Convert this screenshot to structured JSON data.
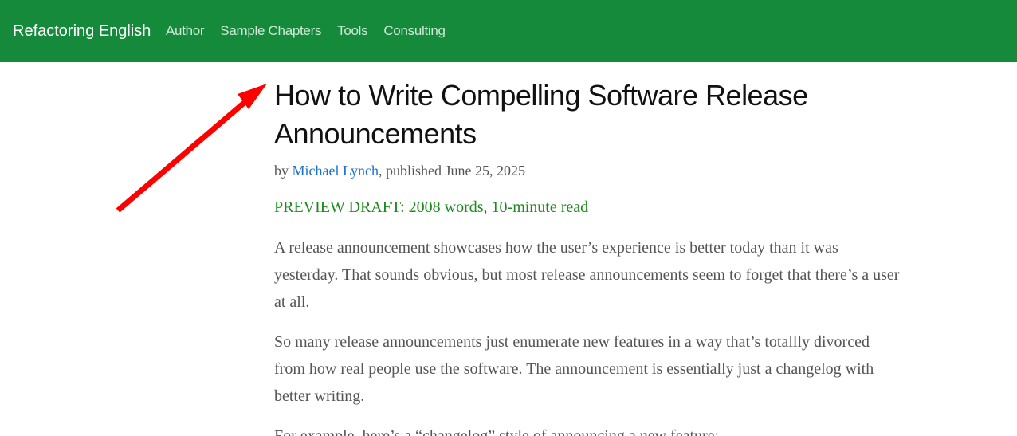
{
  "navbar": {
    "brand": "Refactoring English",
    "links": [
      {
        "label": "Author"
      },
      {
        "label": "Sample Chapters"
      },
      {
        "label": "Tools"
      },
      {
        "label": "Consulting"
      }
    ]
  },
  "article": {
    "title": "How to Write Compelling Software Release Announcements",
    "byline_prefix": "by ",
    "author": "Michael Lynch",
    "byline_suffix": ", published June 25, 2025",
    "preview": "PREVIEW DRAFT: 2008 words, 10-minute read",
    "paragraphs": [
      "A release announcement showcases how the user’s experience is better today than it was yesterday. That sounds obvious, but most release announcements seem to forget that there’s a user at all.",
      "So many release announcements just enumerate new features in a way that’s totallly divorced from how real people use the software. The announcement is essentially just a changelog with better writing.",
      "For example, here’s a “changelog” style of announcing a new feature:"
    ]
  },
  "colors": {
    "navbar_bg": "#148a3a",
    "link_blue": "#1a6fd1",
    "preview_green": "#1d8a1d",
    "arrow_red": "#ff0000"
  },
  "annotation": {
    "icon": "red-arrow-icon"
  }
}
